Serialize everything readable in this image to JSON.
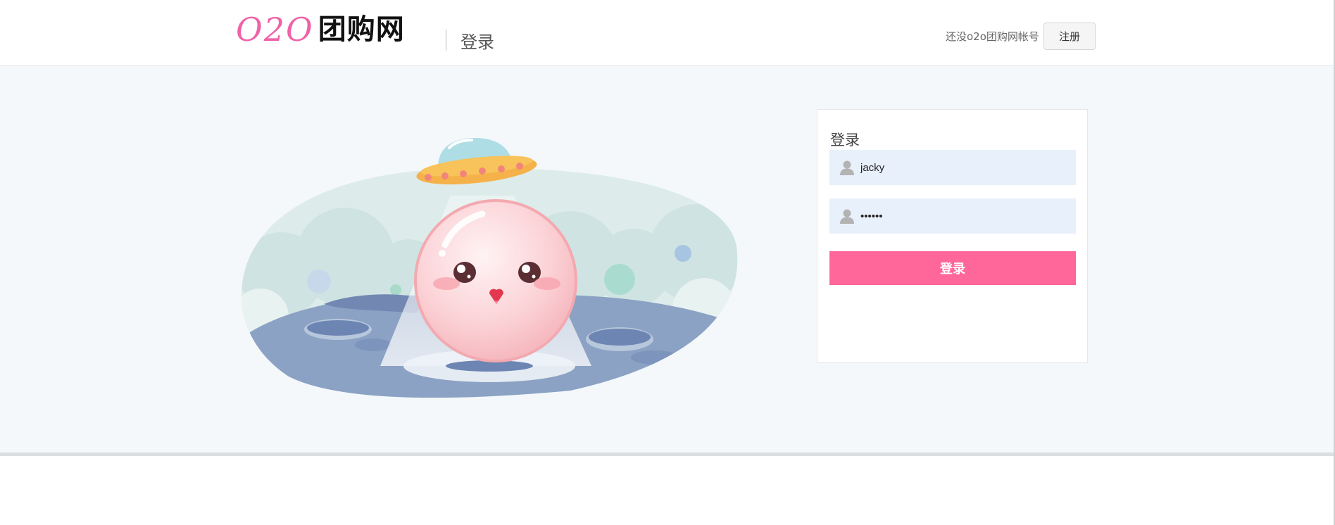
{
  "header": {
    "logo_o2o": "O2O",
    "logo_cn": "团购网",
    "page_title": "登录",
    "register_prompt": "还没o2o团购网帐号",
    "register_label": "注册"
  },
  "login": {
    "title": "登录",
    "username_value": "jacky",
    "password_value": "••••••",
    "submit_label": "登录"
  },
  "colors": {
    "brand_pink": "#ff6699",
    "logo_pink": "#f062a8",
    "input_bg": "#e8f0fc",
    "band_bg": "#f4f8fb"
  },
  "icons": {
    "field_icon": "user-icon"
  }
}
